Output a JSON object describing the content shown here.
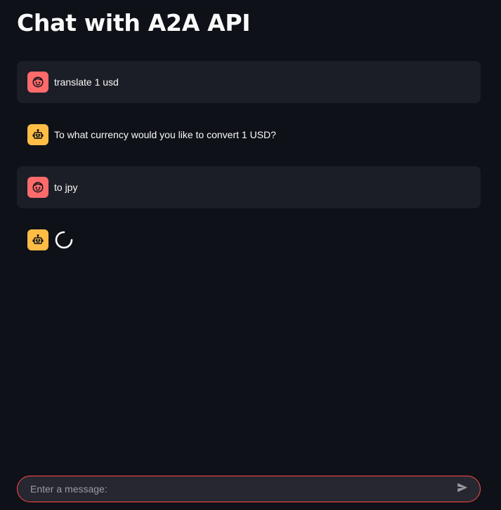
{
  "page": {
    "title": "Chat with A2A API"
  },
  "colors": {
    "background": "#0e1117",
    "user_avatar": "#ff6b6b",
    "assistant_avatar": "#ffbd45",
    "user_bubble": "#1b1e26",
    "input_border": "#ff4b4b"
  },
  "messages": [
    {
      "role": "user",
      "icon": "user-face-icon",
      "text": "translate 1 usd"
    },
    {
      "role": "assistant",
      "icon": "robot-icon",
      "text": "To what currency would you like to convert 1 USD?"
    },
    {
      "role": "user",
      "icon": "user-face-icon",
      "text": "to jpy"
    },
    {
      "role": "assistant",
      "icon": "robot-icon",
      "text": "",
      "loading": true
    }
  ],
  "chat_input": {
    "placeholder": "Enter a message:",
    "value": "",
    "send_icon": "send-icon"
  }
}
